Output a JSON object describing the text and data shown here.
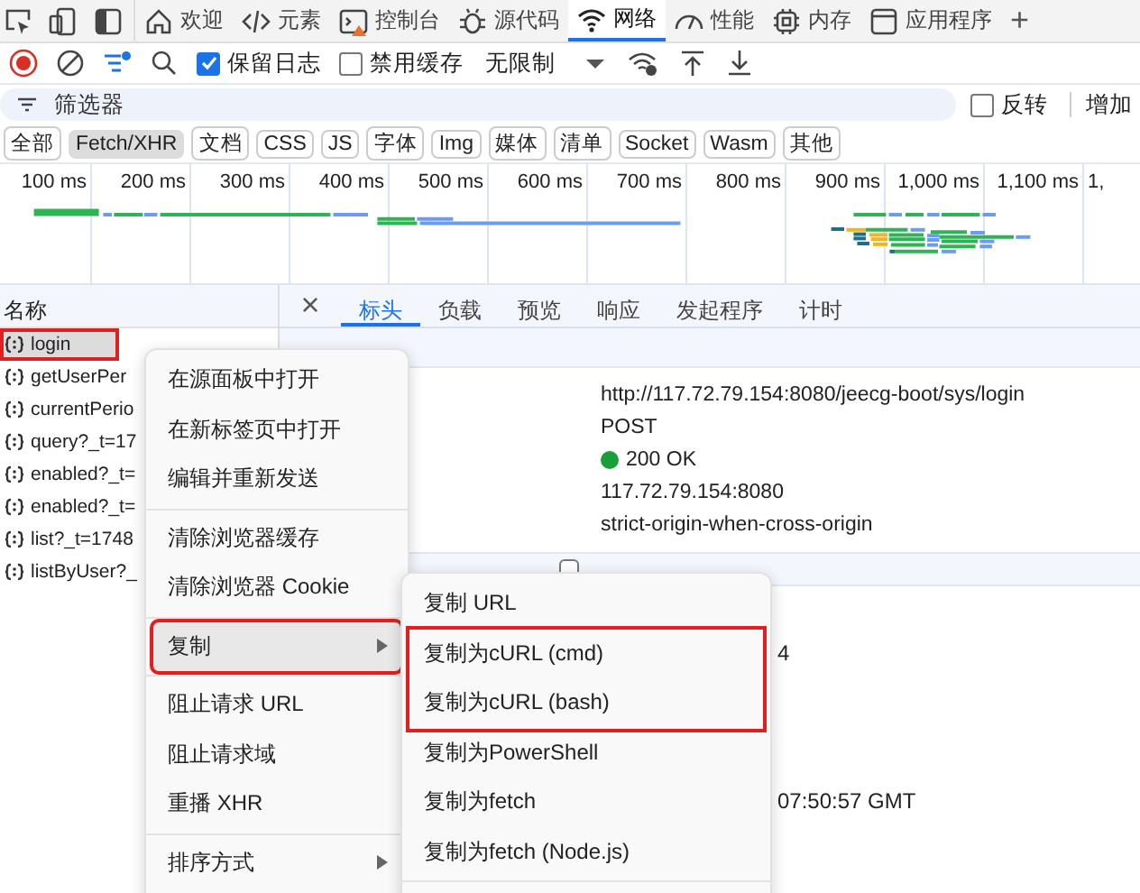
{
  "panel_tabs": [
    {
      "label": "欢迎",
      "selected": false
    },
    {
      "label": "元素",
      "selected": false
    },
    {
      "label": "控制台",
      "selected": false
    },
    {
      "label": "源代码",
      "selected": false
    },
    {
      "label": "网络",
      "selected": true
    },
    {
      "label": "性能",
      "selected": false
    },
    {
      "label": "内存",
      "selected": false
    },
    {
      "label": "应用程序",
      "selected": false
    }
  ],
  "new_tab_label": "+",
  "toolbar": {
    "recording": true,
    "preserve_log": {
      "label": "保留日志",
      "checked": true
    },
    "disable_cache": {
      "label": "禁用缓存",
      "checked": false
    },
    "throttling": "无限制"
  },
  "filter": {
    "placeholder": "筛选器",
    "invert": {
      "label": "反转",
      "checked": false
    },
    "more": "增加"
  },
  "type_filters": [
    {
      "label": "全部",
      "selected": false
    },
    {
      "label": "Fetch/XHR",
      "selected": true
    },
    {
      "label": "文档",
      "selected": false
    },
    {
      "label": "CSS",
      "selected": false
    },
    {
      "label": "JS",
      "selected": false
    },
    {
      "label": "字体",
      "selected": false
    },
    {
      "label": "Img",
      "selected": false
    },
    {
      "label": "媒体",
      "selected": false
    },
    {
      "label": "清单",
      "selected": false
    },
    {
      "label": "Socket",
      "selected": false
    },
    {
      "label": "Wasm",
      "selected": false
    },
    {
      "label": "其他",
      "selected": false
    }
  ],
  "timeline_ticks": [
    "100 ms",
    "200 ms",
    "300 ms",
    "400 ms",
    "500 ms",
    "600 ms",
    "700 ms",
    "800 ms",
    "900 ms",
    "1,000 ms",
    "1,100 ms",
    "1,"
  ],
  "requests": {
    "column": "名称",
    "rows": [
      {
        "name": "login",
        "selected": true,
        "outlined": true
      },
      {
        "name": "getUserPer",
        "selected": false,
        "outlined": false
      },
      {
        "name": "currentPerio",
        "selected": false,
        "outlined": false
      },
      {
        "name": "query?_t=17",
        "selected": false,
        "outlined": false
      },
      {
        "name": "enabled?_t=",
        "selected": false,
        "outlined": false
      },
      {
        "name": "enabled?_t=",
        "selected": false,
        "outlined": false
      },
      {
        "name": "list?_t=1748",
        "selected": false,
        "outlined": false
      },
      {
        "name": "listByUser?_",
        "selected": false,
        "outlined": false
      }
    ]
  },
  "detail_tabs": [
    {
      "label": "标头",
      "selected": true
    },
    {
      "label": "负载",
      "selected": false
    },
    {
      "label": "预览",
      "selected": false
    },
    {
      "label": "响应",
      "selected": false
    },
    {
      "label": "发起程序",
      "selected": false
    },
    {
      "label": "计时",
      "selected": false
    }
  ],
  "close_label": "×",
  "general": [
    {
      "value": "http://117.72.79.154:8080/jeecg-boot/sys/login"
    },
    {
      "value": "POST"
    },
    {
      "value": "200 OK",
      "color": "#1a9e3a"
    },
    {
      "value": "117.72.79.154:8080"
    },
    {
      "value": "strict-origin-when-cross-origin"
    }
  ],
  "response_headers": {
    "raw_checked": false,
    "fragments": [
      "4",
      "07:50:57 GMT"
    ]
  },
  "context_menu": [
    {
      "kind": "item",
      "label": "在源面板中打开",
      "submenu": false,
      "active": false,
      "outlined": false
    },
    {
      "kind": "item",
      "label": "在新标签页中打开",
      "submenu": false,
      "active": false,
      "outlined": false
    },
    {
      "kind": "item",
      "label": "编辑并重新发送",
      "submenu": false,
      "active": false,
      "outlined": false
    },
    {
      "kind": "separator"
    },
    {
      "kind": "item",
      "label": "清除浏览器缓存",
      "submenu": false,
      "active": false,
      "outlined": false
    },
    {
      "kind": "item",
      "label": "清除浏览器 Cookie",
      "submenu": false,
      "active": false,
      "outlined": false
    },
    {
      "kind": "separator"
    },
    {
      "kind": "item",
      "label": "复制",
      "submenu": true,
      "active": true,
      "outlined": true
    },
    {
      "kind": "separator"
    },
    {
      "kind": "item",
      "label": "阻止请求 URL",
      "submenu": false,
      "active": false,
      "outlined": false
    },
    {
      "kind": "item",
      "label": "阻止请求域",
      "submenu": false,
      "active": false,
      "outlined": false
    },
    {
      "kind": "item",
      "label": "重播 XHR",
      "submenu": false,
      "active": false,
      "outlined": false
    },
    {
      "kind": "separator"
    },
    {
      "kind": "item",
      "label": "排序方式",
      "submenu": true,
      "active": false,
      "outlined": false
    }
  ],
  "submenu": [
    {
      "kind": "item",
      "label": "复制 URL",
      "outlined": false
    },
    {
      "kind": "item",
      "label": "复制为cURL (cmd)",
      "outlined": true
    },
    {
      "kind": "item",
      "label": "复制为cURL (bash)",
      "outlined": true
    },
    {
      "kind": "item",
      "label": "复制为PowerShell",
      "outlined": false
    },
    {
      "kind": "item",
      "label": "复制为fetch",
      "outlined": false
    },
    {
      "kind": "item",
      "label": "复制为fetch (Node.js)",
      "outlined": false
    },
    {
      "kind": "separator"
    }
  ]
}
